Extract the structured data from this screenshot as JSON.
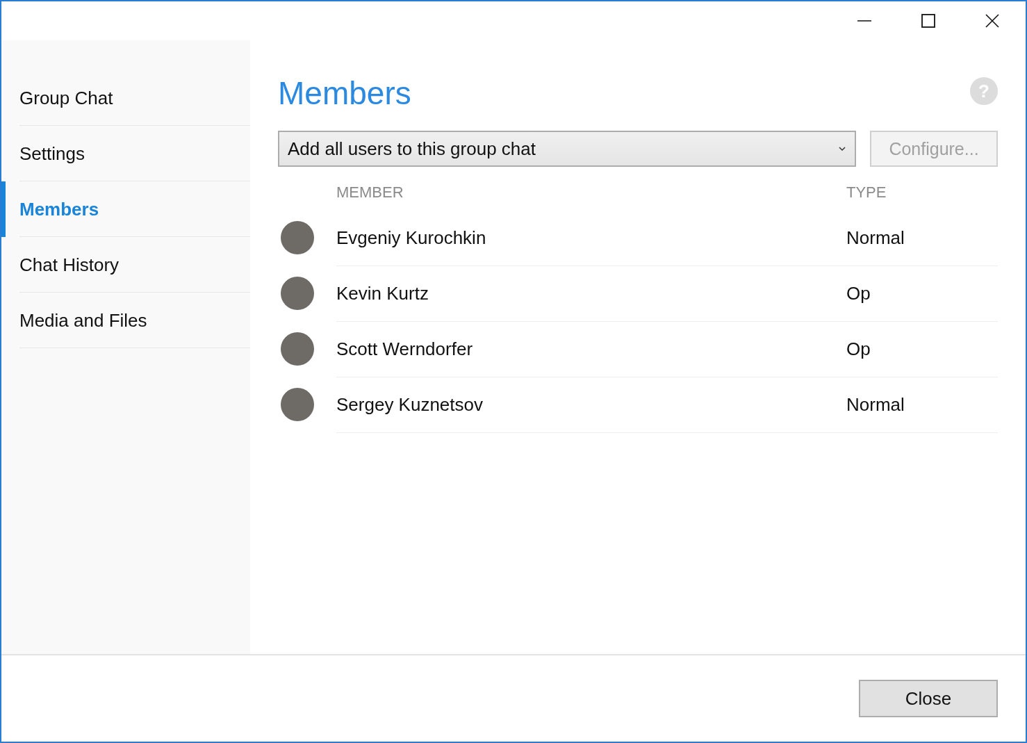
{
  "sidebar": {
    "items": [
      {
        "label": "Group Chat",
        "selected": false
      },
      {
        "label": "Settings",
        "selected": false
      },
      {
        "label": "Members",
        "selected": true
      },
      {
        "label": "Chat History",
        "selected": false
      },
      {
        "label": "Media and Files",
        "selected": false
      }
    ]
  },
  "main": {
    "title": "Members",
    "help": "?",
    "dropdown": {
      "value": "Add all users to this group chat"
    },
    "configure_button": {
      "label": "Configure...",
      "disabled": true
    },
    "table": {
      "columns": [
        "MEMBER",
        "TYPE"
      ],
      "rows": [
        {
          "name": "Evgeniy Kurochkin",
          "type": "Normal"
        },
        {
          "name": "Kevin Kurtz",
          "type": "Op"
        },
        {
          "name": "Scott Werndorfer",
          "type": "Op"
        },
        {
          "name": "Sergey Kuznetsov",
          "type": "Normal"
        }
      ]
    }
  },
  "footer": {
    "close_button": "Close"
  }
}
